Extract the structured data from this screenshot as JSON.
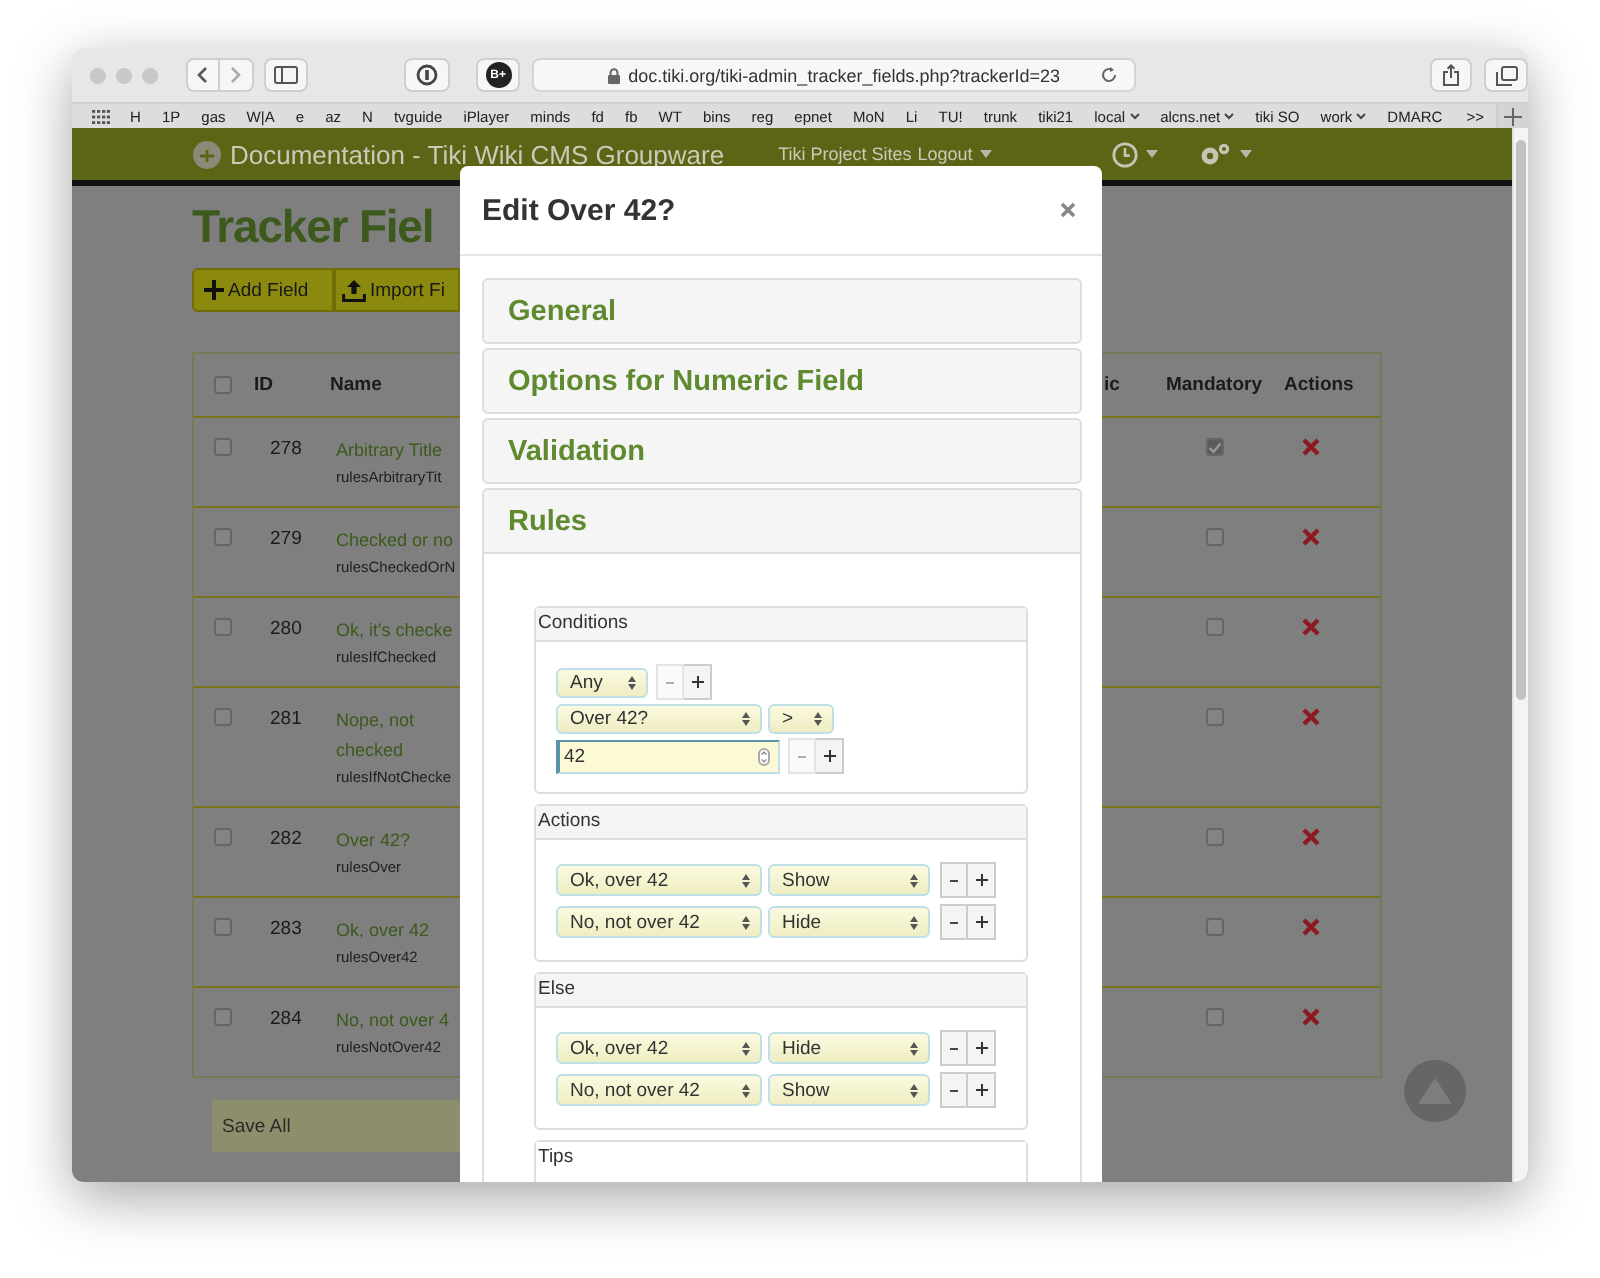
{
  "browser": {
    "extension_badge": "B+",
    "url": "doc.tiki.org/tiki-admin_tracker_fields.php?trackerId=23",
    "bookmarks": [
      {
        "label": "H",
        "folder": false
      },
      {
        "label": "1P",
        "folder": false
      },
      {
        "label": "gas",
        "folder": false
      },
      {
        "label": "W|A",
        "folder": false
      },
      {
        "label": "e",
        "folder": false
      },
      {
        "label": "az",
        "folder": false
      },
      {
        "label": "N",
        "folder": false
      },
      {
        "label": "tvguide",
        "folder": false
      },
      {
        "label": "iPlayer",
        "folder": false
      },
      {
        "label": "minds",
        "folder": false
      },
      {
        "label": "fd",
        "folder": false
      },
      {
        "label": "fb",
        "folder": false
      },
      {
        "label": "WT",
        "folder": false
      },
      {
        "label": "bins",
        "folder": false
      },
      {
        "label": "reg",
        "folder": false
      },
      {
        "label": "epnet",
        "folder": false
      },
      {
        "label": "MoN",
        "folder": false
      },
      {
        "label": "Li",
        "folder": false
      },
      {
        "label": "TU!",
        "folder": false
      },
      {
        "label": "trunk",
        "folder": false
      },
      {
        "label": "tiki21",
        "folder": false
      },
      {
        "label": "local",
        "folder": true
      },
      {
        "label": "alcns.net",
        "folder": true
      },
      {
        "label": "tiki SO",
        "folder": false
      },
      {
        "label": "work",
        "folder": true
      },
      {
        "label": "DMARC",
        "folder": false
      }
    ],
    "bookmarks_more": ">>"
  },
  "site_header": {
    "title": "Documentation - Tiki Wiki CMS Groupware",
    "menu": [
      "Tiki Project Sites",
      "Logout"
    ]
  },
  "page": {
    "title": "Tracker Fiel",
    "buttons": [
      {
        "kind": "add",
        "label": "Add Field"
      },
      {
        "kind": "import",
        "label": "Import Fi"
      }
    ],
    "save_label": "Save All"
  },
  "table": {
    "all_selected": false,
    "columns": [
      "ID",
      "Name",
      "ic",
      "Mandatory",
      "Actions"
    ],
    "rows": [
      {
        "id": "278",
        "name": "Arbitrary Title",
        "perm_name": "rulesArbitraryTit",
        "selected": false,
        "mandatory": true
      },
      {
        "id": "279",
        "name": "Checked or no",
        "perm_name": "rulesCheckedOrN",
        "selected": false,
        "mandatory": false
      },
      {
        "id": "280",
        "name": "Ok, it's checke",
        "perm_name": "rulesIfChecked",
        "selected": false,
        "mandatory": false
      },
      {
        "id": "281",
        "name": "Nope, not checked",
        "perm_name": "rulesIfNotChecke",
        "selected": false,
        "mandatory": false
      },
      {
        "id": "282",
        "name": "Over 42?",
        "perm_name": "rulesOver",
        "selected": false,
        "mandatory": false
      },
      {
        "id": "283",
        "name": "Ok, over 42",
        "perm_name": "rulesOver42",
        "selected": false,
        "mandatory": false
      },
      {
        "id": "284",
        "name": "No, not over 4",
        "perm_name": "rulesNotOver42",
        "selected": false,
        "mandatory": false
      }
    ]
  },
  "modal": {
    "title": "Edit Over 42?",
    "sections": [
      {
        "label": "General",
        "expanded": false
      },
      {
        "label": "Options for Numeric Field",
        "expanded": false
      },
      {
        "label": "Validation",
        "expanded": false
      },
      {
        "label": "Rules",
        "expanded": true
      }
    ],
    "rules": {
      "conditions": {
        "title": "Conditions",
        "logic": "Any",
        "field": "Over 42?",
        "operator": ">",
        "value": "42",
        "remove_disabled": true
      },
      "actions": {
        "title": "Actions",
        "rows": [
          {
            "field": "Ok, over 42",
            "action": "Show"
          },
          {
            "field": "No, not over 42",
            "action": "Hide"
          }
        ]
      },
      "else": {
        "title": "Else",
        "rows": [
          {
            "field": "Ok, over 42",
            "action": "Hide"
          },
          {
            "field": "No, not over 42",
            "action": "Show"
          }
        ]
      },
      "tips": {
        "title": "Tips"
      }
    }
  }
}
